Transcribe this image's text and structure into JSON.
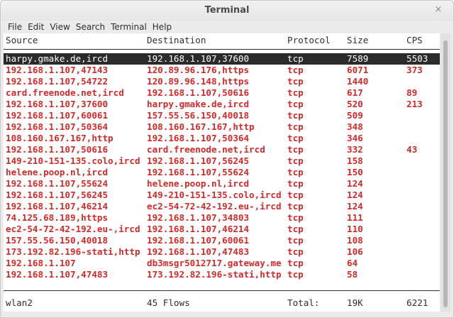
{
  "window": {
    "title": "Terminal",
    "close_glyph": "×"
  },
  "menu": [
    "File",
    "Edit",
    "View",
    "Search",
    "Terminal",
    "Help"
  ],
  "table": {
    "headers": [
      "Source",
      "Destination",
      "Protocol",
      "Size",
      "CPS"
    ],
    "selected_index": 0,
    "rows": [
      {
        "source": "harpy.gmake.de,ircd",
        "destination": "192.168.1.107,37600",
        "protocol": "tcp",
        "size": "7589",
        "cps": "5503"
      },
      {
        "source": "192.168.1.107,47143",
        "destination": "120.89.96.176,https",
        "protocol": "tcp",
        "size": "6071",
        "cps": "373"
      },
      {
        "source": "192.168.1.107,54722",
        "destination": "120.89.96.148,https",
        "protocol": "tcp",
        "size": "1440",
        "cps": ""
      },
      {
        "source": "card.freenode.net,ircd",
        "destination": "192.168.1.107,50616",
        "protocol": "tcp",
        "size": "617",
        "cps": "89"
      },
      {
        "source": "192.168.1.107,37600",
        "destination": "harpy.gmake.de,ircd",
        "protocol": "tcp",
        "size": "520",
        "cps": "213"
      },
      {
        "source": "192.168.1.107,60061",
        "destination": "157.55.56.150,40018",
        "protocol": "tcp",
        "size": "509",
        "cps": ""
      },
      {
        "source": "192.168.1.107,50364",
        "destination": "108.160.167.167,http",
        "protocol": "tcp",
        "size": "348",
        "cps": ""
      },
      {
        "source": "108.160.167.167,http",
        "destination": "192.168.1.107,50364",
        "protocol": "tcp",
        "size": "346",
        "cps": ""
      },
      {
        "source": "192.168.1.107,50616",
        "destination": "card.freenode.net,ircd",
        "protocol": "tcp",
        "size": "332",
        "cps": "43"
      },
      {
        "source": "149-210-151-135.colo,ircd",
        "destination": "192.168.1.107,56245",
        "protocol": "tcp",
        "size": "158",
        "cps": ""
      },
      {
        "source": "helene.poop.nl,ircd",
        "destination": "192.168.1.107,55624",
        "protocol": "tcp",
        "size": "150",
        "cps": ""
      },
      {
        "source": "192.168.1.107,55624",
        "destination": "helene.poop.nl,ircd",
        "protocol": "tcp",
        "size": "124",
        "cps": ""
      },
      {
        "source": "192.168.1.107,56245",
        "destination": "149-210-151-135.colo,ircd",
        "protocol": "tcp",
        "size": "124",
        "cps": ""
      },
      {
        "source": "192.168.1.107,46214",
        "destination": "ec2-54-72-42-192.eu-,ircd",
        "protocol": "tcp",
        "size": "124",
        "cps": ""
      },
      {
        "source": "74.125.68.189,https",
        "destination": "192.168.1.107,34803",
        "protocol": "tcp",
        "size": "111",
        "cps": ""
      },
      {
        "source": "ec2-54-72-42-192.eu-,ircd",
        "destination": "192.168.1.107,46214",
        "protocol": "tcp",
        "size": "110",
        "cps": ""
      },
      {
        "source": "157.55.56.150,40018",
        "destination": "192.168.1.107,60061",
        "protocol": "tcp",
        "size": "108",
        "cps": ""
      },
      {
        "source": "173.192.82.196-stati,http",
        "destination": "192.168.1.107,47483",
        "protocol": "tcp",
        "size": "106",
        "cps": ""
      },
      {
        "source": "192.168.1.107",
        "destination": "db3msgr5012717.gateway.me",
        "protocol": "tcp",
        "size": "64",
        "cps": ""
      },
      {
        "source": "192.168.1.107,47483",
        "destination": "173.192.82.196-stati,http",
        "protocol": "tcp",
        "size": "58",
        "cps": ""
      }
    ]
  },
  "footer": {
    "interface": "wlan2",
    "flows": "45 Flows",
    "total_label": "Total:",
    "total_size": "19K",
    "total_cps": "6221"
  }
}
